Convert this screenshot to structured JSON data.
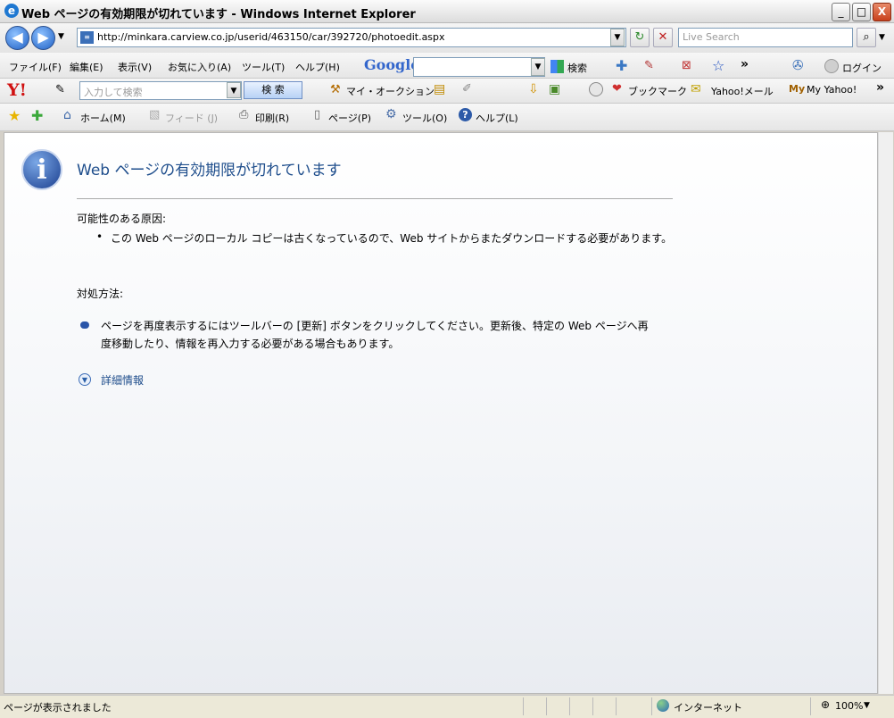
{
  "window": {
    "title": "Web ページの有効期限が切れています - Windows Internet Explorer",
    "minimize": "_",
    "maximize": "□",
    "close": "X"
  },
  "navigation": {
    "address": "http://minkara.carview.co.jp/userid/463150/car/392720/photoedit.aspx",
    "search_placeholder": "Live Search"
  },
  "menubar": {
    "items": [
      "ファイル(F)",
      "編集(E)",
      "表示(V)",
      "お気に入り(A)",
      "ツール(T)",
      "ヘルプ(H)"
    ],
    "google_logo": "Google",
    "google_search": "検索",
    "login": "ログイン"
  },
  "yahoo_toolbar": {
    "search_placeholder": "入力して検索",
    "search_button": "検 索",
    "auction": "マイ・オークション",
    "bookmark": "ブックマーク",
    "mail": "Yahoo!メール",
    "my_yahoo": "My Yahoo!"
  },
  "command_bar": {
    "home": "ホーム(M)",
    "feed": "フィード (J)",
    "print": "印刷(R)",
    "page": "ページ(P)",
    "tools": "ツール(O)",
    "help": "ヘルプ(L)"
  },
  "error_page": {
    "title": "Web ページの有効期限が切れています",
    "cause_heading": "可能性のある原因:",
    "cause_bullet": "この Web ページのローカル コピーは古くなっているので、Web サイトからまたダウンロードする必要があります。",
    "action_heading": "対処方法:",
    "action_bullet": "ページを再度表示するにはツールバーの [更新] ボタンをクリックしてください。更新後、特定の Web ページへ再度移動したり、情報を再入力する必要がある場合もあります。",
    "more_info": "詳細情報"
  },
  "statusbar": {
    "message": "ページが表示されました",
    "zone": "インターネット",
    "zoom": "100%"
  }
}
